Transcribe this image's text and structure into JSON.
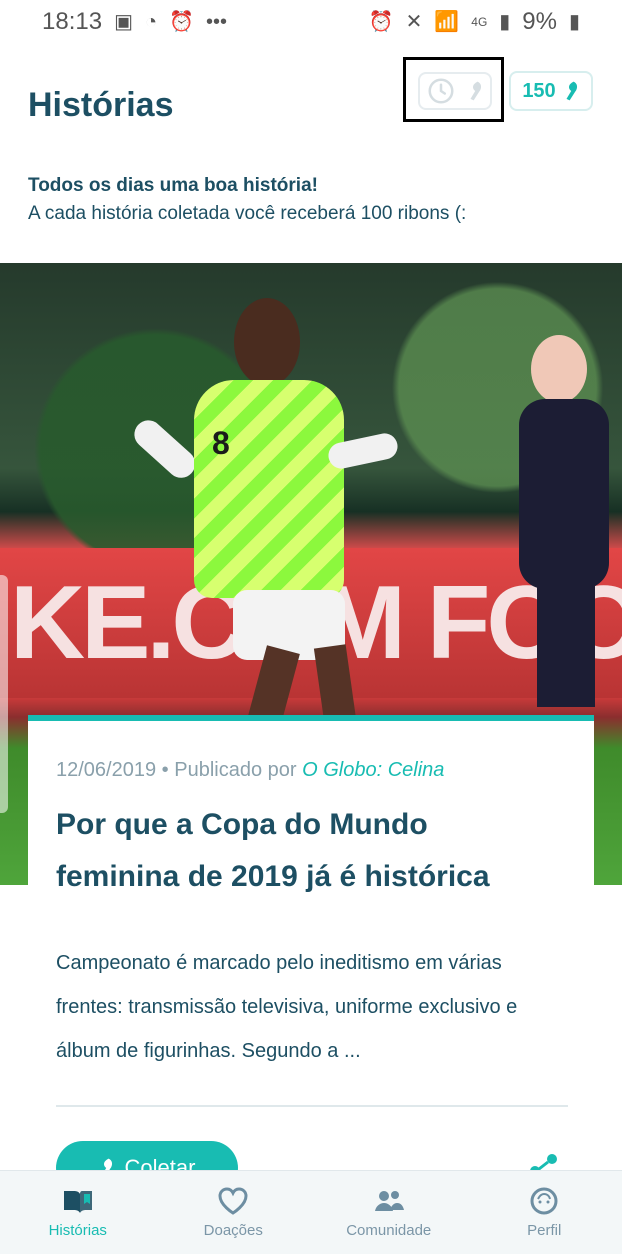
{
  "status_bar": {
    "time": "18:13",
    "network": "4G",
    "battery": "9%"
  },
  "header": {
    "title": "Histórias",
    "ribbons_count": "150"
  },
  "intro": {
    "headline": "Todos os dias uma boa história!",
    "subtitle": "A cada história coletada você receberá 100 ribons (:"
  },
  "hero": {
    "banner_text": "KE.COM FOO",
    "player_number": "8"
  },
  "story": {
    "date": "12/06/2019",
    "separator": "•",
    "published_by_label": "Publicado por",
    "source": "O Globo: Celina",
    "title": "Por que a Copa do Mundo feminina de 2019 já é histórica",
    "text": "Campeonato é marcado pelo ineditismo em várias frentes: transmissão televisiva, uniforme exclusivo e álbum de figurinhas. Segundo a ...",
    "collect_label": "Coletar"
  },
  "bottom_nav": [
    {
      "label": "Histórias",
      "icon": "book-icon"
    },
    {
      "label": "Doações",
      "icon": "heart-icon"
    },
    {
      "label": "Comunidade",
      "icon": "people-icon"
    },
    {
      "label": "Perfil",
      "icon": "profile-icon"
    }
  ],
  "colors": {
    "accent": "#18bcb2",
    "title": "#1d4f63",
    "muted": "#7b96a7"
  }
}
